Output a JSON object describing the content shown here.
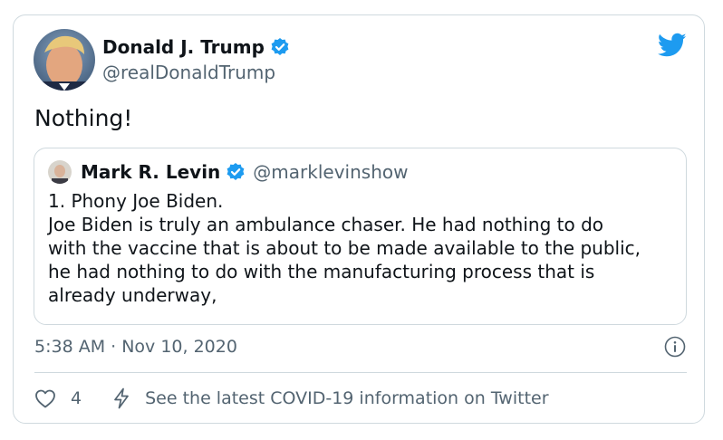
{
  "author": {
    "name": "Donald J. Trump",
    "handle": "@realDonaldTrump"
  },
  "tweet": {
    "text": "Nothing!"
  },
  "quoted": {
    "name": "Mark R. Levin",
    "handle": "@marklevinshow",
    "lines": [
      "1. Phony Joe Biden.",
      "Joe Biden is truly an ambulance chaser.  He had nothing to do",
      "with the vaccine that is about to be made available to the public,",
      "he had nothing to do with the manufacturing process that is",
      "already underway,"
    ]
  },
  "meta": {
    "timestamp": "5:38 AM · Nov 10, 2020"
  },
  "actions": {
    "like_count": "4",
    "covid_info": "See the latest COVID-19 information on Twitter"
  },
  "icons": {
    "verified": "verified-badge-icon",
    "brand": "twitter-bird-icon",
    "info": "info-icon",
    "like": "heart-icon",
    "covid": "lightning-icon"
  },
  "colors": {
    "brand": "#1d9bf0",
    "secondary_text": "#536471",
    "border": "#cfd9de"
  }
}
